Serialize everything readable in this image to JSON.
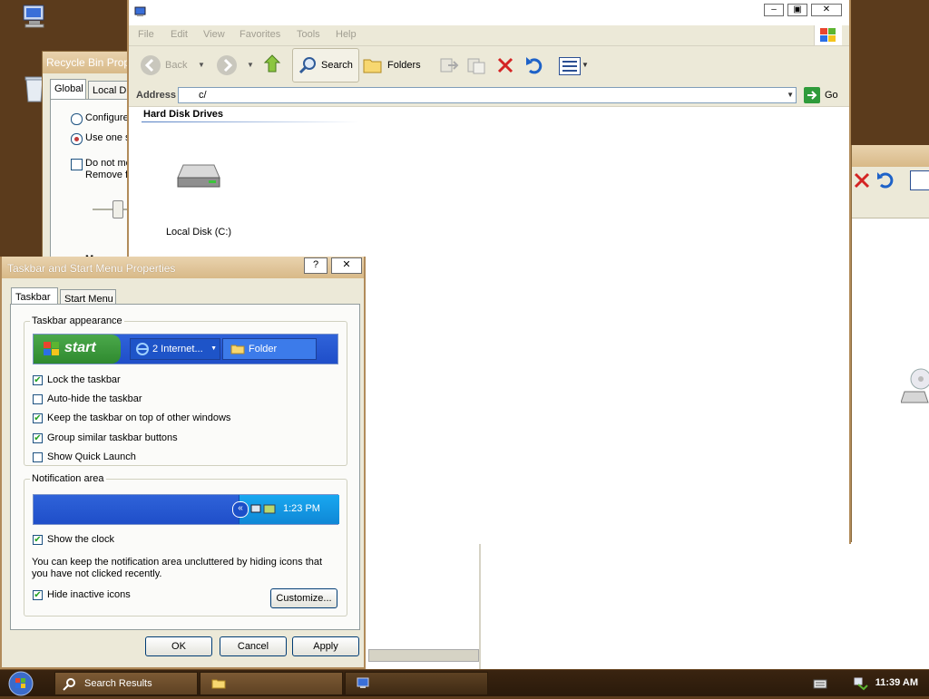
{
  "desktop": {
    "icons": [
      "my-computer-icon",
      "recycle-bin-icon"
    ]
  },
  "recycle_bin_window": {
    "title": "Recycle Bin Prop",
    "tabs": [
      "Global",
      "Local Di"
    ],
    "options": [
      "Configure",
      "Use one s",
      "Do not mo",
      "Remove f"
    ],
    "extra_label": "M"
  },
  "explorer": {
    "menu": [
      "File",
      "Edit",
      "View",
      "Favorites",
      "Tools",
      "Help"
    ],
    "toolbar": {
      "back_label": "Back",
      "search_label": "Search",
      "folders_label": "Folders"
    },
    "address": {
      "label": "Address",
      "value": "c/",
      "go_label": "Go"
    },
    "group_header": "Hard Disk Drives",
    "items": [
      {
        "label": "Local Disk (C:)",
        "icon": "hard-disk-icon"
      }
    ]
  },
  "taskbar_properties": {
    "title": "Taskbar and Start Menu Properties",
    "help_label": "?",
    "close_label": "✕",
    "tabs": [
      "Taskbar",
      "Start Menu"
    ],
    "appearance": {
      "group_label": "Taskbar appearance",
      "preview": {
        "start_label": "start",
        "task1_label": "2 Internet...",
        "task2_label": "Folder"
      },
      "options": [
        {
          "label": "Lock the taskbar",
          "checked": true
        },
        {
          "label": "Auto-hide the taskbar",
          "checked": false
        },
        {
          "label": "Keep the taskbar on top of other windows",
          "checked": true
        },
        {
          "label": "Group similar taskbar buttons",
          "checked": true
        },
        {
          "label": "Show Quick Launch",
          "checked": false
        }
      ]
    },
    "notification": {
      "group_label": "Notification area",
      "preview_time": "1:23 PM",
      "show_clock": {
        "label": "Show the clock",
        "checked": true
      },
      "description": "You can keep the notification area uncluttered by hiding icons that you have not clicked recently.",
      "hide_inactive": {
        "label": "Hide inactive icons",
        "checked": true
      },
      "customize_label": "Customize..."
    },
    "buttons": {
      "ok": "OK",
      "cancel": "Cancel",
      "apply": "Apply"
    }
  },
  "system_taskbar": {
    "tasks": [
      {
        "label": "Search Results",
        "icon": "search-icon"
      },
      {
        "label": "",
        "icon": "folder-icon"
      },
      {
        "label": "",
        "icon": "computer-icon"
      }
    ],
    "clock": "11:39 AM"
  },
  "colors": {
    "desktop_bg": "#5b3b1c",
    "accent_window_border": "#b18b5a",
    "xp_taskbar_blue": "#2f63d9",
    "start_green": "#3a9b3a"
  }
}
